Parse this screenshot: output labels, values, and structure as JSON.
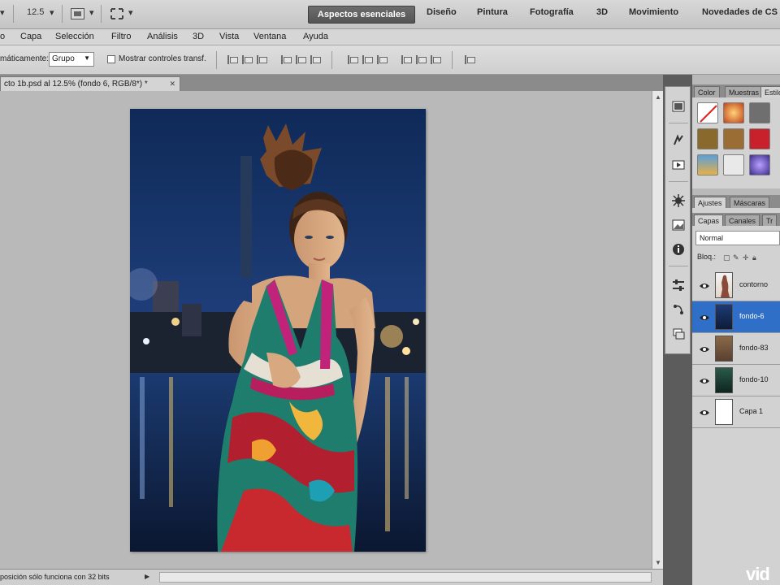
{
  "app_bar": {
    "zoom_value": "12.5",
    "workspaces": [
      {
        "label": "Aspectos esenciales",
        "active": true
      },
      {
        "label": "Diseño"
      },
      {
        "label": "Pintura"
      },
      {
        "label": "Fotografía"
      },
      {
        "label": "3D"
      },
      {
        "label": "Movimiento"
      },
      {
        "label": "Novedades de CS"
      }
    ]
  },
  "menu": [
    "o",
    "Capa",
    "Selección",
    "Filtro",
    "Análisis",
    "3D",
    "Vista",
    "Ventana",
    "Ayuda"
  ],
  "options_bar": {
    "auto_select_label": "máticamente:",
    "auto_select_value": "Grupo",
    "show_transform_label": "Mostrar controles transf."
  },
  "document": {
    "tab_title": "cto 1b.psd al 12.5% (fondo 6, RGB/8*) *",
    "status_text": "posición sólo funciona con 32 bits"
  },
  "panels": {
    "top_tabs": [
      "Color",
      "Muestras",
      "Estilos"
    ],
    "adjust_tabs": [
      "Ajustes",
      "Máscaras"
    ],
    "layers_tabs": [
      "Capas",
      "Canales",
      "Tr"
    ],
    "blend_mode": "Normal",
    "lock_label": "Bloq.:"
  },
  "layers": [
    {
      "name": "contorno",
      "selected": false
    },
    {
      "name": "fondo-6",
      "selected": true
    },
    {
      "name": "fondo-83",
      "selected": false
    },
    {
      "name": "fondo-10",
      "selected": false
    },
    {
      "name": "Capa 1",
      "selected": false
    }
  ],
  "watermark": "vid",
  "colors": {
    "accent_selected": "#2f6fc8",
    "ui_gray": "#d2d2d2"
  }
}
